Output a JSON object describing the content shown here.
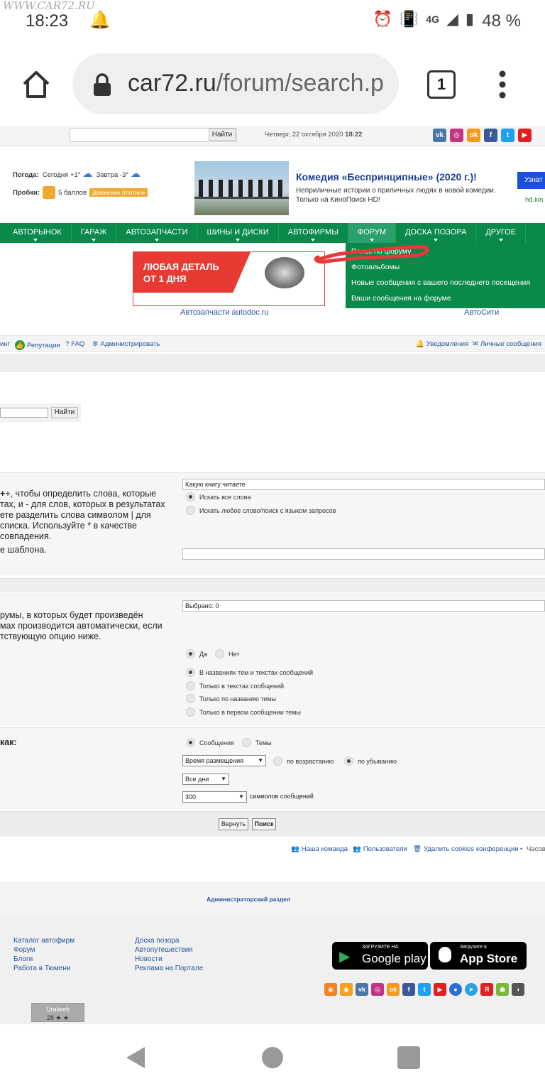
{
  "status": {
    "watermark": "WWW.CAR72.RU",
    "time": "18:23",
    "network": "4G",
    "battery": "48 %"
  },
  "browser": {
    "url_host": "car72.ru",
    "url_path": "/forum/search.p",
    "tab_count": "1"
  },
  "topbar": {
    "search_button": "Найти",
    "date_prefix": "Четверг, 22 октября 2020",
    "date_time": "18:22"
  },
  "weather": {
    "label": "Погода:",
    "today": "Сегодня +1°",
    "tomorrow": "Завтра -3°",
    "traffic_label": "Пробки:",
    "traffic_value": "5 баллов",
    "traffic_badge": "Движение плотное"
  },
  "ad": {
    "title": "Комедия «Беспринципные» (2020 г.)!",
    "text": "Неприличные истории о приличных людях в новой комедии. Только на КиноПоиск HD!",
    "button": "Узнат",
    "link": "hd.kin"
  },
  "nav": [
    "АВТОРЫНОК",
    "ГАРАЖ",
    "АВТОЗАПЧАСТИ",
    "ШИНЫ И ДИСКИ",
    "АВТОФИРМЫ",
    "ФОРУМ",
    "ДОСКА ПОЗОРА",
    "ДРУГОЕ"
  ],
  "dropdown": [
    "Поиск по форуму",
    "Фотоальбомы",
    "Новые сообщения с вашего последнего посещения",
    "Ваши сообщения на форуме"
  ],
  "banner": {
    "line1": "ЛЮБАЯ ДЕТАЛЬ",
    "line2": "ОТ 1 ДНЯ",
    "caption1": "Автозапчасти autodoc.ru",
    "caption2": "АвтоСити"
  },
  "toolbar": {
    "rating_tail": "инг",
    "reputation": "Репутация",
    "faq": "FAQ",
    "admin": "Администрировать",
    "notifications": "Уведомления",
    "messages": "Личные сообщения"
  },
  "search_find": "Найти",
  "keywords": {
    "value": "Какую книгу читаете",
    "desc_lines": [
      "+, чтобы определить слова, которые",
      "тах, и - для слов, которых в результатах",
      "ете разделить слова символом | для",
      "списка. Используйте * в качестве",
      "совпадения."
    ],
    "desc_tail": "е шаблона.",
    "opt_all": "Искать все слова",
    "opt_any": "Искать любое слово/поиск с языком запросов"
  },
  "forums": {
    "selected": "Выбрано: 0",
    "desc_lines": [
      "румы, в которых будет произведён",
      "мах производится автоматически, если",
      "тствующую опцию ниже."
    ],
    "yes": "Да",
    "no": "Нет",
    "in_titles_and_text": "В названиях тем и текстах сообщений",
    "only_text": "Только в текстах сообщений",
    "only_titles": "Только по названию темы",
    "only_first": "Только в первом сообщении темы"
  },
  "display": {
    "label": "как:",
    "posts": "Сообщения",
    "topics": "Темы",
    "sort_by": "Время размещения",
    "asc": "по возрастанию",
    "desc": "по убыванию",
    "days": "Все дни",
    "chars": "300",
    "chars_label": "символов сообщений"
  },
  "buttons": {
    "reset": "Вернуть",
    "search": "Поиск"
  },
  "footer_links": {
    "team": "Наша команда",
    "users": "Пользователи",
    "delete_cookies": "Удалить cookies конференции",
    "tz": "Часов"
  },
  "admin_section": "Администраторский раздел",
  "footer": {
    "col1": [
      "Каталог автофирм",
      "Форум",
      "Блоги",
      "Работа в Тюмени"
    ],
    "col2": [
      "Доска позора",
      "Автопутешествия",
      "Новости",
      "Реклама на Портале"
    ],
    "gp_small": "ЗАГРУЗИТЕ НА",
    "gp_big": "Google play",
    "as_small": "Загрузите в",
    "as_big": "App Store",
    "counter_name": "Uralweb",
    "counter_value": "28 ★ ★"
  }
}
